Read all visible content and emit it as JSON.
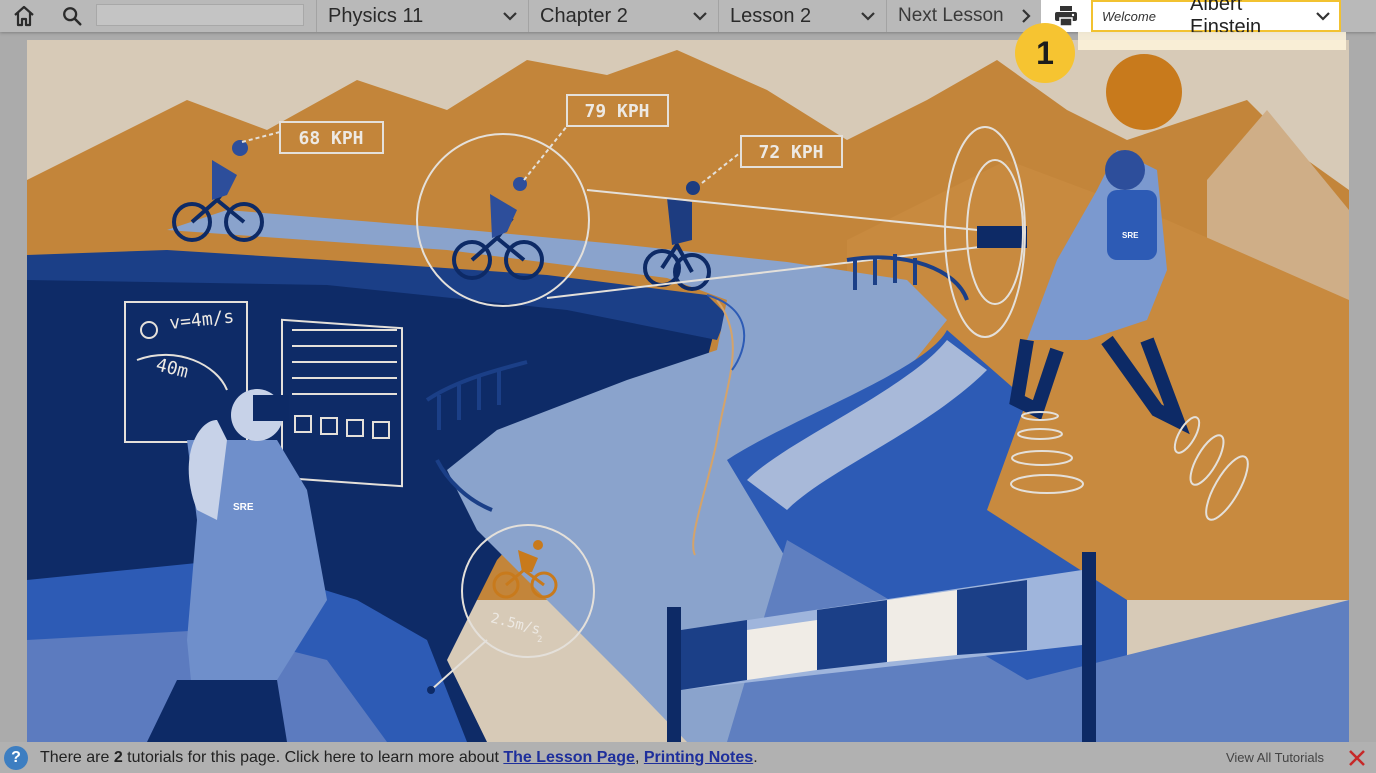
{
  "nav": {
    "home_icon": "home-icon",
    "search_icon": "search-icon",
    "search_value": "",
    "course": "Physics 11",
    "chapter": "Chapter 2",
    "lesson": "Lesson 2",
    "next_lesson": "Next Lesson",
    "print_icon": "print-icon",
    "welcome": "Welcome",
    "user_name": "Albert Einstein"
  },
  "callout_badge": "1",
  "illustration": {
    "speed_1": "68 KPH",
    "speed_2": "79 KPH",
    "speed_3": "72 KPH",
    "velocity": "v=4m/s",
    "distance": "40m",
    "acceleration": "2.5m/s",
    "acceleration_exp": "2",
    "logo_text": "SRE",
    "colors": {
      "sky": "#ddd0bd",
      "mountain": "#c8873a",
      "navy": "#0d2a66",
      "blue": "#2d5bb5",
      "light_blue": "#7f9bcf",
      "road": "#8aa2cc",
      "orange": "#d4811f"
    }
  },
  "tutorial_bar": {
    "prefix": "There are ",
    "count": "2",
    "middle": " tutorials for this page. Click here to learn more about ",
    "link1": "The Lesson Page",
    "sep": ", ",
    "link2": "Printing Notes",
    "suffix": ".",
    "view_all": "View All Tutorials"
  }
}
